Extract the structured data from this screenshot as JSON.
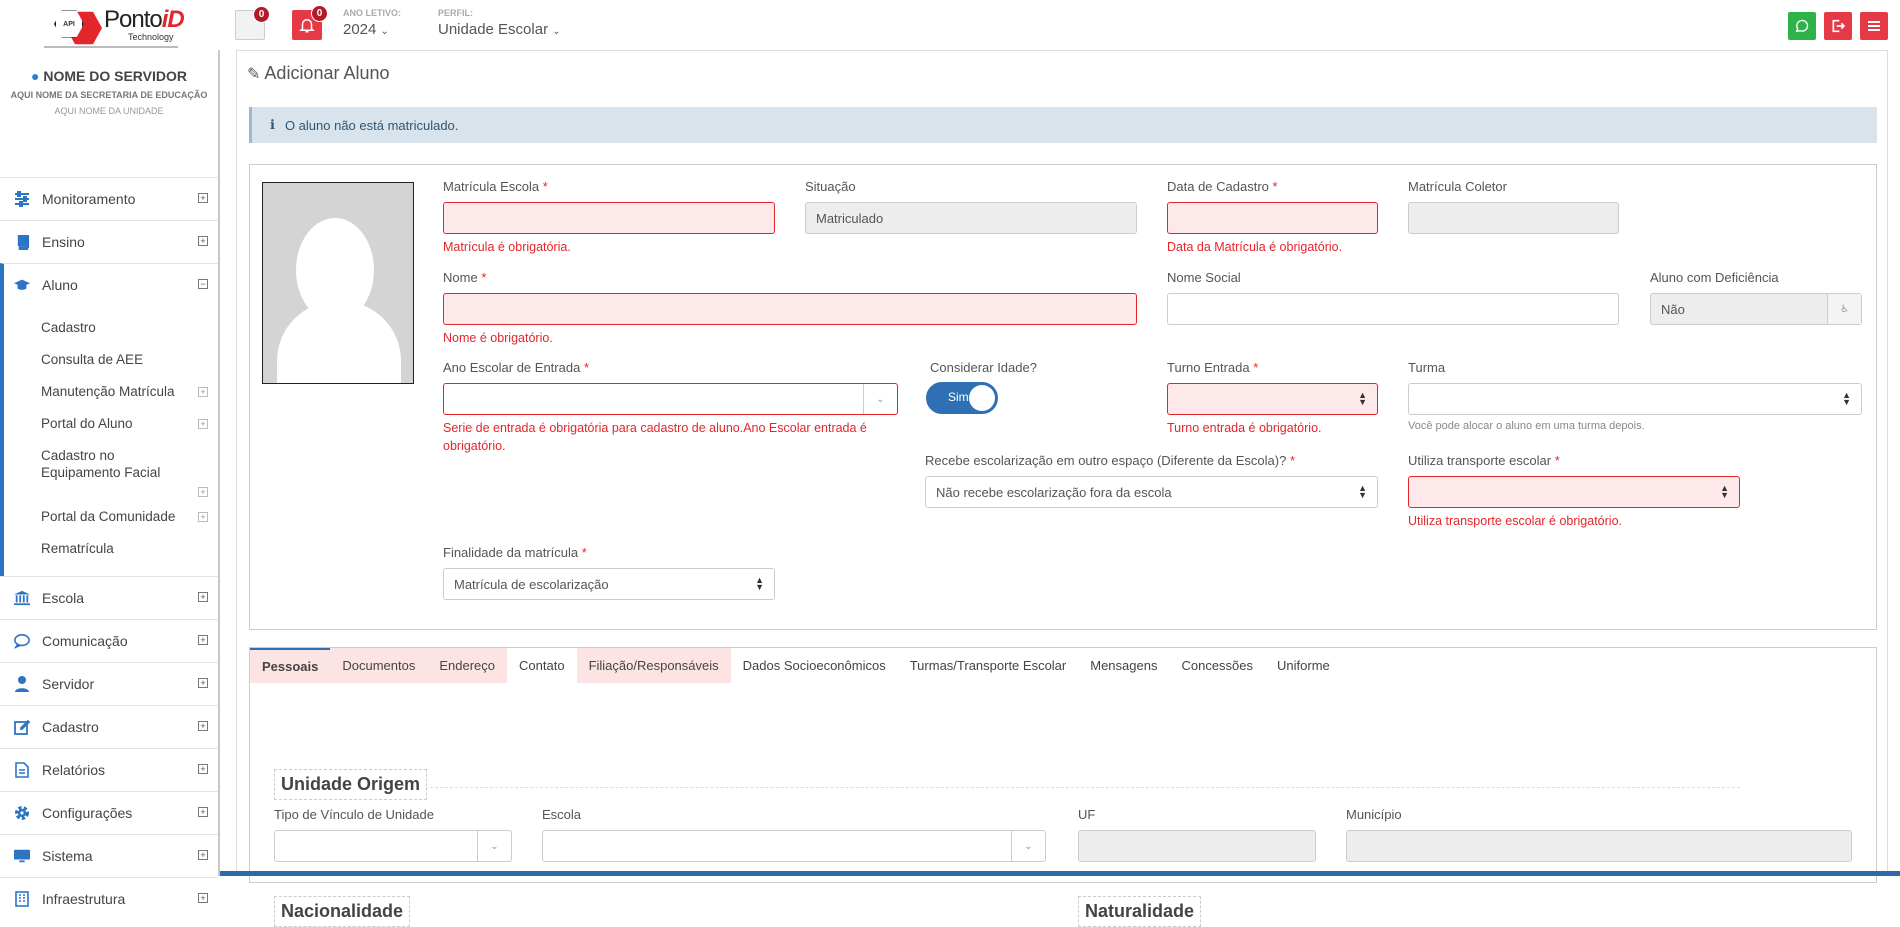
{
  "header": {
    "brand_prefix": "Ponto",
    "brand_suffix": "iD",
    "brand_sub": "Technology",
    "logo_api": "API",
    "mail_badge": "0",
    "bell_badge": "0",
    "ano_letivo_label": "ANO LETIVO:",
    "ano_letivo_value": "2024",
    "perfil_label": "PERFIL:",
    "perfil_value": "Unidade Escolar",
    "colors": {
      "whatsapp": "#2fb349",
      "logout": "#e53945",
      "menu": "#e53945"
    }
  },
  "sidebar": {
    "server_name": "NOME DO SERVIDOR",
    "secretaria": "AQUI NOME DA SECRETARIA DE EDUCAÇÃO",
    "unidade": "AQUI NOME DA UNIDADE",
    "items": [
      {
        "label": "Monitoramento",
        "icon": "sliders-icon"
      },
      {
        "label": "Ensino",
        "icon": "book-icon"
      },
      {
        "label": "Aluno",
        "icon": "graduation-cap-icon"
      },
      {
        "label": "Escola",
        "icon": "bank-icon"
      },
      {
        "label": "Comunicação",
        "icon": "chat-icon"
      },
      {
        "label": "Servidor",
        "icon": "user-icon"
      },
      {
        "label": "Cadastro",
        "icon": "edit-icon"
      },
      {
        "label": "Relatórios",
        "icon": "file-icon"
      },
      {
        "label": "Configurações",
        "icon": "gear-icon"
      },
      {
        "label": "Sistema",
        "icon": "monitor-icon"
      },
      {
        "label": "Infraestrutura",
        "icon": "building-icon"
      }
    ],
    "aluno_sub": [
      "Cadastro",
      "Consulta de AEE",
      "Manutenção Matrícula",
      "Portal do Aluno",
      "Cadastro no Equipamento Facial",
      "Portal da Comunidade",
      "Rematrícula"
    ]
  },
  "main": {
    "title": "Adicionar Aluno",
    "alert": "O aluno não está matriculado.",
    "form": {
      "matricula_escola": {
        "label": "Matrícula Escola",
        "req": "*",
        "value": "",
        "error": "Matrícula é obrigatória."
      },
      "situacao": {
        "label": "Situação",
        "value": "Matriculado"
      },
      "data_cadastro": {
        "label": "Data de Cadastro",
        "req": "*",
        "value": "",
        "error": "Data da Matrícula é obrigatório."
      },
      "matricula_coletor": {
        "label": "Matrícula Coletor",
        "value": ""
      },
      "nome": {
        "label": "Nome",
        "req": "*",
        "value": "",
        "error": "Nome é obrigatório."
      },
      "nome_social": {
        "label": "Nome Social",
        "value": ""
      },
      "aluno_deficiencia": {
        "label": "Aluno com Deficiência",
        "value": "Não"
      },
      "ano_escolar": {
        "label": "Ano Escolar de Entrada",
        "req": "*",
        "value": "",
        "error": "Serie de entrada é obrigatória para cadastro de aluno.Ano Escolar entrada é obrigatório."
      },
      "considerar_idade": {
        "label": "Considerar Idade?",
        "value": "Sim"
      },
      "turno_entrada": {
        "label": "Turno Entrada",
        "req": "*",
        "value": "",
        "error": "Turno entrada é obrigatório."
      },
      "turma": {
        "label": "Turma",
        "value": "",
        "help": "Você pode alocar o aluno em uma turma depois."
      },
      "recebe_escolarizacao": {
        "label": "Recebe escolarização em outro espaço (Diferente da Escola)?",
        "req": "*",
        "value": "Não recebe escolarização fora da escola"
      },
      "transporte": {
        "label": "Utiliza transporte escolar",
        "req": "*",
        "value": "",
        "error": "Utiliza transporte escolar é obrigatório."
      },
      "finalidade": {
        "label": "Finalidade da matrícula",
        "req": "*",
        "value": "Matrícula de escolarização"
      }
    },
    "tabs": [
      "Pessoais",
      "Documentos",
      "Endereço",
      "Contato",
      "Filiação/Responsáveis",
      "Dados Socioeconômicos",
      "Turmas/Transporte Escolar",
      "Mensagens",
      "Concessões",
      "Uniforme"
    ],
    "pessoais": {
      "unidade_origem_title": "Unidade Origem",
      "tipo_vinculo_label": "Tipo de Vínculo de Unidade",
      "escola_label": "Escola",
      "uf_label": "UF",
      "municipio_label": "Município",
      "nacionalidade_title": "Nacionalidade",
      "naturalidade_title": "Naturalidade"
    }
  }
}
